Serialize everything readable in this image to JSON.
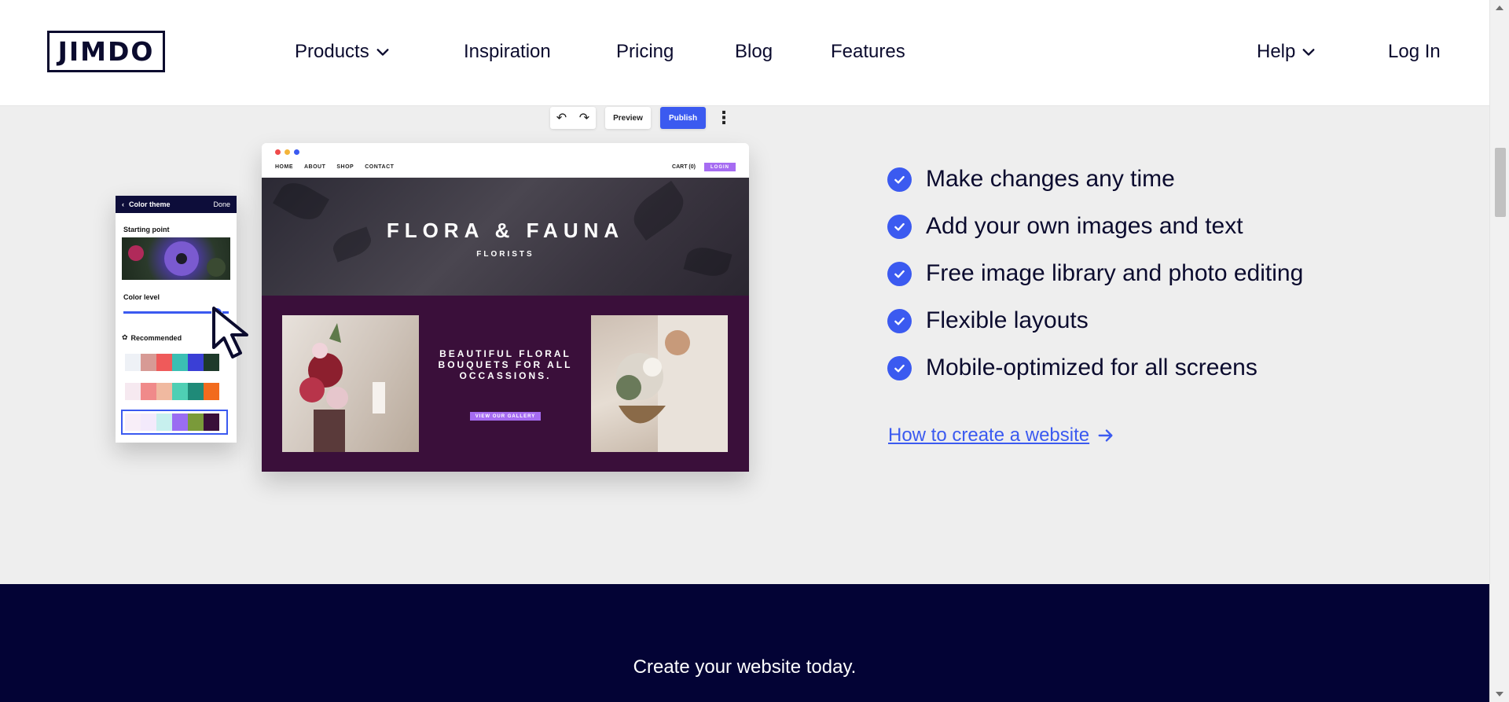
{
  "header": {
    "logo": "JIMDO",
    "nav": [
      {
        "label": "Products",
        "has_dropdown": true
      },
      {
        "label": "Inspiration",
        "has_dropdown": false
      },
      {
        "label": "Pricing",
        "has_dropdown": false
      },
      {
        "label": "Blog",
        "has_dropdown": false
      },
      {
        "label": "Features",
        "has_dropdown": false
      }
    ],
    "help": {
      "label": "Help",
      "has_dropdown": true
    },
    "login": "Log In"
  },
  "editor": {
    "toolbar": {
      "undo_icon": "undo-icon",
      "redo_icon": "redo-icon",
      "preview": "Preview",
      "publish": "Publish",
      "more_icon": "more-vertical-icon"
    },
    "site": {
      "nav": [
        "HOME",
        "ABOUT",
        "SHOP",
        "CONTACT"
      ],
      "cart": "CART (0)",
      "login": "LOGIN",
      "title": "FLORA & FAUNA",
      "subtitle": "FLORISTS",
      "tagline": "BEAUTIFUL FLORAL BOUQUETS FOR ALL OCCASSIONS.",
      "gallery_button": "VIEW OUR GALLERY"
    },
    "color_panel": {
      "title": "Color theme",
      "done": "Done",
      "starting_point": "Starting point",
      "color_level": "Color level",
      "recommended": "Recommended",
      "palettes": [
        [
          "#eef1f6",
          "#d79a95",
          "#ef5a5a",
          "#3bbfb3",
          "#3a3fd6",
          "#1e3a2b"
        ],
        [
          "#f6e9f0",
          "#f08a8a",
          "#f0b9a0",
          "#4fcfb4",
          "#1f8a78",
          "#f26b1d"
        ],
        [
          "#f8eef8",
          "#f3eafb",
          "#c7f0ee",
          "#9a6cf2",
          "#7a9a3a",
          "#3a0f3a"
        ]
      ]
    }
  },
  "features": [
    "Make changes any time",
    "Add your own images and text",
    "Free image library and photo editing",
    "Flexible layouts",
    "Mobile-optimized for all screens"
  ],
  "how_link": "How to create a website",
  "cta_band": {
    "text": "Create your website today."
  },
  "colors": {
    "accent": "#3b5af0",
    "navy": "#030335",
    "purple": "#a66cf2",
    "plum": "#3a0f3a"
  }
}
